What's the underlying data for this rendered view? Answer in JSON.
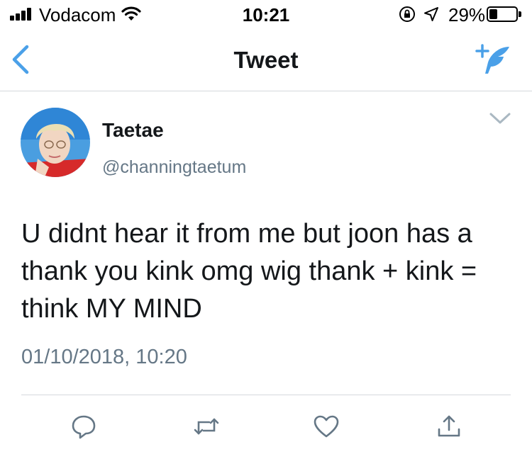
{
  "status_bar": {
    "carrier": "Vodacom",
    "time": "10:21",
    "battery_percent": "29%",
    "battery_level": 0.29
  },
  "nav": {
    "title": "Tweet"
  },
  "tweet": {
    "display_name": "Taetae",
    "handle": "@channingtaetum",
    "text": "U didnt hear it from me but joon has a thank you kink omg wig thank + kink = think MY MIND",
    "timestamp": "01/10/2018, 10:20"
  },
  "colors": {
    "accent": "#1da1f2",
    "nav_icon": "#4aa0e8",
    "secondary_text": "#657786",
    "action_icon": "#657786",
    "divider": "#d5d8dc"
  },
  "icons": {
    "back": "chevron-left-icon",
    "compose": "compose-tweet-icon",
    "caret": "chevron-down-icon",
    "reply": "reply-icon",
    "retweet": "retweet-icon",
    "like": "like-icon",
    "share": "share-icon"
  }
}
